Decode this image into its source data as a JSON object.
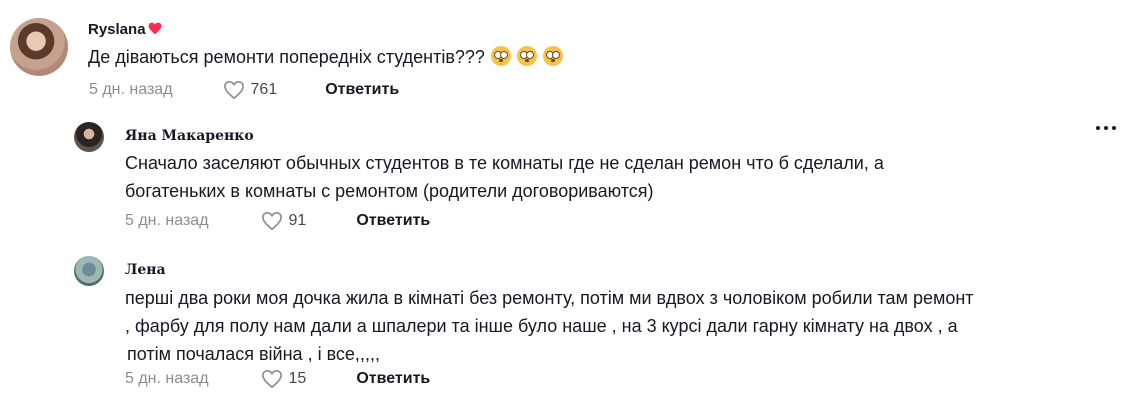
{
  "comments": [
    {
      "user": "Ryslana",
      "badge_icon": "heart-icon",
      "text": "Де діваються ремонти попередніх студентів???",
      "emojis": [
        "flushed-face-icon",
        "flushed-face-icon",
        "flushed-face-icon"
      ],
      "time": "5 дн. назад",
      "likes": "761",
      "reply_label": "Ответить"
    },
    {
      "user": "Яна Макаренко",
      "text_line1": "Сначало заселяют обычных студентов в те комнаты где не сделан ремон что б сделали, а",
      "text_line2": "богатеньких в комнаты с ремонтом (родители договориваются)",
      "time": "5 дн. назад",
      "likes": "91",
      "reply_label": "Ответить"
    },
    {
      "user": "Лена",
      "text_line1": "перші два роки моя дочка жила в кімнаті без ремонту, потім ми вдвох з чоловіком робили там ремонт",
      "text_line2": ", фарбу для полу нам дали а шпалери та інше було наше , на 3 курсі дали гарну кімнату на двох , а",
      "text_line3": "потім почалася війна , і все,,,,,",
      "time": "5 дн. назад",
      "likes": "15",
      "reply_label": "Ответить"
    }
  ],
  "colors": {
    "text": "#161823",
    "muted": "#8a8b91",
    "badge": "#fe2c55"
  }
}
